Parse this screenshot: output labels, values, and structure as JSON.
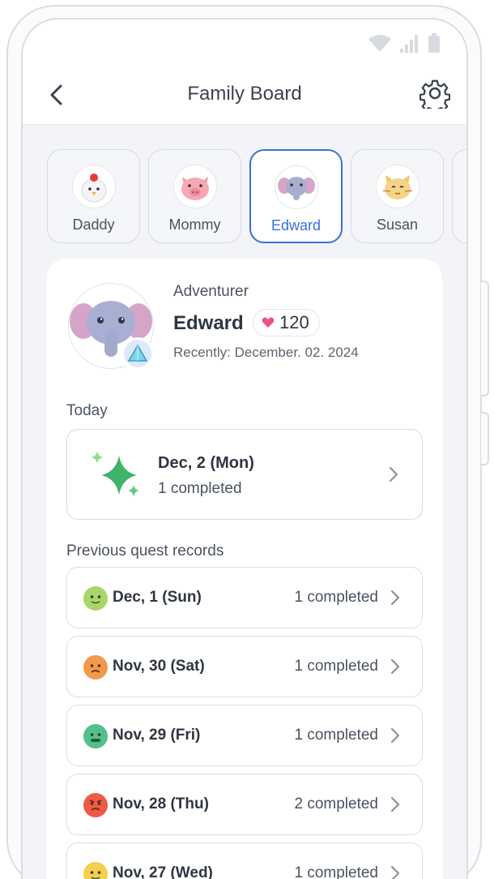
{
  "header": {
    "title": "Family Board"
  },
  "members": [
    {
      "name": "Daddy",
      "animal": "chicken",
      "active": false
    },
    {
      "name": "Mommy",
      "animal": "pig",
      "active": false
    },
    {
      "name": "Edward",
      "animal": "elephant",
      "active": true
    },
    {
      "name": "Susan",
      "animal": "cat",
      "active": false
    }
  ],
  "profile": {
    "role": "Adventurer",
    "name": "Edward",
    "hearts": "120",
    "recent": "Recently: December. 02. 2024"
  },
  "today": {
    "label": "Today",
    "date": "Dec, 2 (Mon)",
    "count": "1 completed"
  },
  "previous": {
    "label": "Previous quest records",
    "records": [
      {
        "date": "Dec, 1 (Sun)",
        "count": "1 completed",
        "mood": "light-green-face",
        "color": "#a9d66b"
      },
      {
        "date": "Nov, 30 (Sat)",
        "count": "1 completed",
        "mood": "orange-face",
        "color": "#f29a4a"
      },
      {
        "date": "Nov, 29 (Fri)",
        "count": "1 completed",
        "mood": "green-face",
        "color": "#52c08a"
      },
      {
        "date": "Nov, 28 (Thu)",
        "count": "2 completed",
        "mood": "red-face",
        "color": "#ef5a45"
      },
      {
        "date": "Nov, 27 (Wed)",
        "count": "1 completed",
        "mood": "yellow-face",
        "color": "#f4cf4b"
      }
    ]
  },
  "colors": {
    "accent": "#3b6fd8",
    "heart": "#f0508a",
    "background": "#f2f4f8"
  }
}
